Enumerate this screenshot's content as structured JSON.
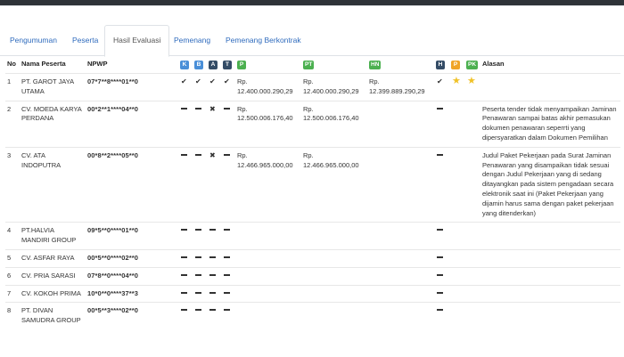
{
  "tabs": [
    {
      "label": "Pengumuman",
      "active": false
    },
    {
      "label": "Peserta",
      "active": false
    },
    {
      "label": "Hasil Evaluasi",
      "active": true
    },
    {
      "label": "Pemenang",
      "active": false
    },
    {
      "label": "Pemenang Berkontrak",
      "active": false
    }
  ],
  "header": {
    "no": "No",
    "nama": "Nama Peserta",
    "npwp": "NPWP",
    "k": "K",
    "b": "B",
    "a": "A",
    "t": "T",
    "p": "P",
    "pt": "PT",
    "hn": "HN",
    "h": "H",
    "p2": "P",
    "pk": "PK",
    "alasan": "Alasan"
  },
  "colors": {
    "tab_link": "#2f6bbd",
    "k": "#4a8fd8",
    "b": "#4a8fd8",
    "a": "#344c66",
    "t": "#344c66",
    "p": "#4cb050",
    "pt": "#4cb050",
    "hn": "#4cb050",
    "h": "#344c66",
    "p2": "#f0a428",
    "pk": "#4cb050",
    "star": "#f0c228"
  },
  "rows": [
    {
      "no": "1",
      "nama": "PT. GAROT JAYA UTAMA",
      "npwp": "07*7**8****01**0",
      "k": "check",
      "b": "check",
      "a": "check",
      "t": "check",
      "p": "Rp. 12.400.000.290,29",
      "pt": "Rp. 12.400.000.290,29",
      "hn": "Rp. 12.399.889.290,29",
      "h": "check",
      "p2": "star",
      "pk": "star",
      "alasan": ""
    },
    {
      "no": "2",
      "nama": "CV. MOEDA KARYA PERDANA",
      "npwp": "00*2**1****04**0",
      "k": "dash",
      "b": "dash",
      "a": "cross",
      "t": "dash",
      "p": "Rp. 12.500.006.176,40",
      "pt": "Rp. 12.500.006.176,40",
      "hn": "",
      "h": "dash",
      "p2": "",
      "pk": "",
      "alasan": "Peserta tender tidak menyampaikan Jaminan Penawaran sampai batas akhir pemasukan dokumen penawaran seperrti yang dipersyaratkan dalam Dokumen Pemilihan"
    },
    {
      "no": "3",
      "nama": "CV. ATA INDOPUTRA",
      "npwp": "00*8**2****05**0",
      "k": "dash",
      "b": "dash",
      "a": "cross",
      "t": "dash",
      "p": "Rp. 12.466.965.000,00",
      "pt": "Rp. 12.466.965.000,00",
      "hn": "",
      "h": "dash",
      "p2": "",
      "pk": "",
      "alasan": "Judul Paket Pekerjaan pada Surat Jaminan Penawaran yang disampaikan tidak sesuai dengan Judul Pekerjaan yang di sedang ditayangkan pada sistem pengadaan secara elektronik saat ini (Paket Pekerjaan yang dijamin harus sama dengan paket pekerjaan yang ditenderkan)"
    },
    {
      "no": "4",
      "nama": "PT.HALVIA MANDIRI GROUP",
      "npwp": "09*5**0****01**0",
      "k": "dash",
      "b": "dash",
      "a": "dash",
      "t": "dash",
      "p": "",
      "pt": "",
      "hn": "",
      "h": "dash",
      "p2": "",
      "pk": "",
      "alasan": ""
    },
    {
      "no": "5",
      "nama": "CV. ASFAR RAYA",
      "npwp": "00*5**0****02**0",
      "k": "dash",
      "b": "dash",
      "a": "dash",
      "t": "dash",
      "p": "",
      "pt": "",
      "hn": "",
      "h": "dash",
      "p2": "",
      "pk": "",
      "alasan": ""
    },
    {
      "no": "6",
      "nama": "CV. PRIA SARASI",
      "npwp": "07*8**0****04**0",
      "k": "dash",
      "b": "dash",
      "a": "dash",
      "t": "dash",
      "p": "",
      "pt": "",
      "hn": "",
      "h": "dash",
      "p2": "",
      "pk": "",
      "alasan": ""
    },
    {
      "no": "7",
      "nama": "CV. KOKOH PRIMA",
      "npwp": "10*0**0****37**3",
      "k": "dash",
      "b": "dash",
      "a": "dash",
      "t": "dash",
      "p": "",
      "pt": "",
      "hn": "",
      "h": "dash",
      "p2": "",
      "pk": "",
      "alasan": ""
    },
    {
      "no": "8",
      "nama": "PT. DIVAN SAMUDRA GROUP",
      "npwp": "00*5**3****02**0",
      "k": "dash",
      "b": "dash",
      "a": "dash",
      "t": "dash",
      "p": "",
      "pt": "",
      "hn": "",
      "h": "dash",
      "p2": "",
      "pk": "",
      "alasan": ""
    }
  ]
}
